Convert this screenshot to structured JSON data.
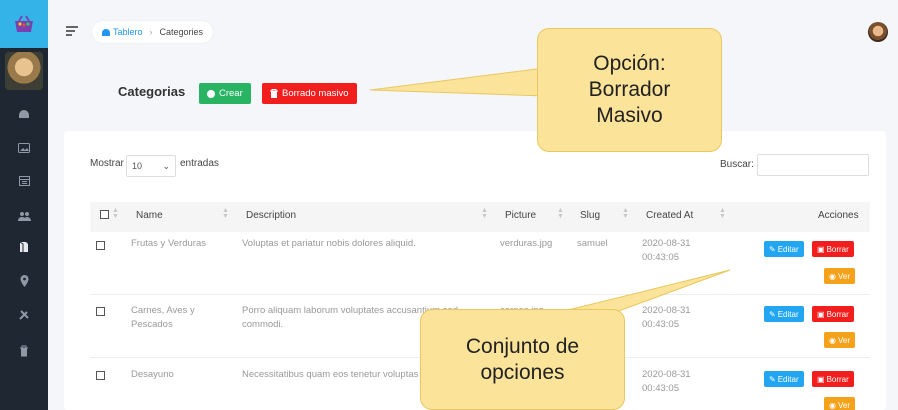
{
  "breadcrumb": {
    "home": "Tablero",
    "current": "Categories"
  },
  "header": {
    "title": "Categorias",
    "create_label": "Crear",
    "bulk_delete_label": "Borrado masivo"
  },
  "controls": {
    "show_prefix": "Mostrar",
    "page_size": "10",
    "show_suffix": "entradas",
    "search_label": "Buscar:",
    "search_value": ""
  },
  "table": {
    "columns": [
      "Name",
      "Description",
      "Picture",
      "Slug",
      "Created At",
      "Acciones"
    ],
    "rows": [
      {
        "name": "Frutas y Verduras",
        "description": "Voluptas et pariatur nobis dolores aliquid.",
        "picture": "verduras.jpg",
        "slug": "samuel",
        "created_at": "2020-08-31 00:43:05"
      },
      {
        "name": "Carnes, Aves y Pescados",
        "description": "Porro aliquam laborum voluptates accusantium sed commodi.",
        "picture": "carnes.jpg",
        "slug": "pao",
        "created_at": "2020-08-31 00:43:05"
      },
      {
        "name": "Desayuno",
        "description": "Necessitatibus quam eos tenetur voluptas",
        "picture": "",
        "slug": "",
        "created_at": "2020-08-31 00:43:05"
      }
    ],
    "actions": {
      "edit": "Editar",
      "delete": "Borrar",
      "view": "Ver"
    }
  },
  "callouts": {
    "top": [
      "Opción:",
      "Borrador",
      "Masivo"
    ],
    "bottom": [
      "Conjunto de",
      "opciones"
    ]
  },
  "colors": {
    "sidebar": "#1f2733",
    "logo_bg": "#33b3e8",
    "create": "#28b463",
    "danger": "#f21d1d",
    "edit": "#22a6f2",
    "view": "#f5a21b",
    "callout": "#fbe39a"
  },
  "icons": {
    "sidebar": [
      "basket-logo-icon",
      "dashboard-icon",
      "image-icon",
      "calendar-icon",
      "users-icon",
      "categories-icon",
      "location-icon",
      "tools-icon",
      "trash-icon"
    ]
  }
}
